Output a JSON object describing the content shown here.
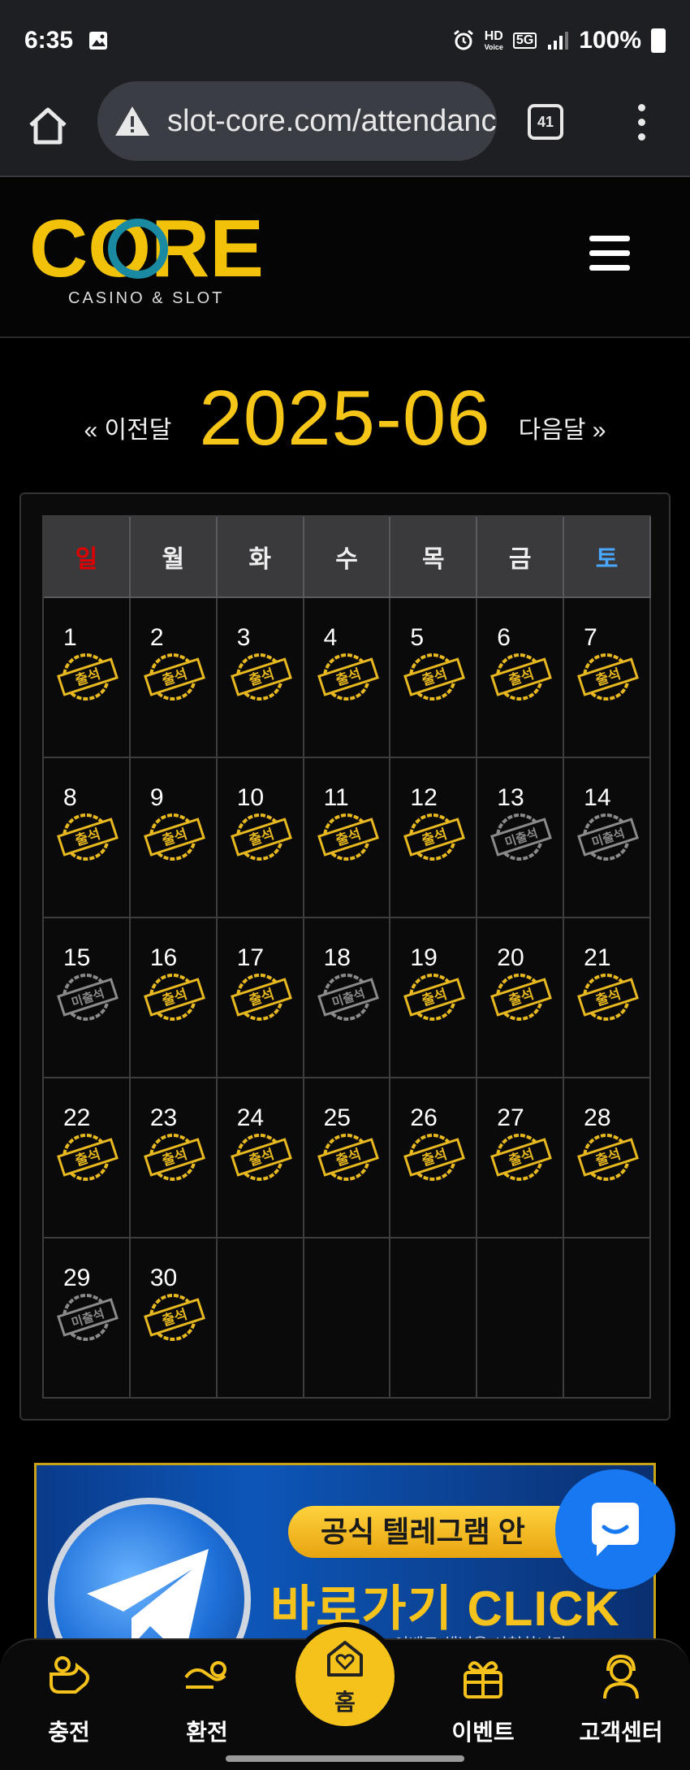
{
  "status_bar": {
    "time": "6:35",
    "hd_label": "HD",
    "voice_label": "Voice",
    "network": "5G",
    "battery": "100%"
  },
  "browser": {
    "url": "slot-core.com/attendance",
    "tab_count": "41"
  },
  "site": {
    "logo_text": "CORE",
    "logo_subtitle": "CASINO & SLOT"
  },
  "calendar": {
    "prev_label": "« 이전달",
    "next_label": "다음달 »",
    "month": "2025-06",
    "weekdays": [
      "일",
      "월",
      "화",
      "수",
      "목",
      "금",
      "토"
    ],
    "attended_label": "출석",
    "absent_label": "미출석",
    "days": [
      {
        "day": "1",
        "status": "attended"
      },
      {
        "day": "2",
        "status": "attended"
      },
      {
        "day": "3",
        "status": "attended"
      },
      {
        "day": "4",
        "status": "attended"
      },
      {
        "day": "5",
        "status": "attended"
      },
      {
        "day": "6",
        "status": "attended"
      },
      {
        "day": "7",
        "status": "attended"
      },
      {
        "day": "8",
        "status": "attended"
      },
      {
        "day": "9",
        "status": "attended"
      },
      {
        "day": "10",
        "status": "attended"
      },
      {
        "day": "11",
        "status": "attended"
      },
      {
        "day": "12",
        "status": "attended"
      },
      {
        "day": "13",
        "status": "absent"
      },
      {
        "day": "14",
        "status": "absent"
      },
      {
        "day": "15",
        "status": "absent"
      },
      {
        "day": "16",
        "status": "attended"
      },
      {
        "day": "17",
        "status": "attended"
      },
      {
        "day": "18",
        "status": "absent"
      },
      {
        "day": "19",
        "status": "attended"
      },
      {
        "day": "20",
        "status": "attended"
      },
      {
        "day": "21",
        "status": "attended"
      },
      {
        "day": "22",
        "status": "attended"
      },
      {
        "day": "23",
        "status": "attended"
      },
      {
        "day": "24",
        "status": "attended"
      },
      {
        "day": "25",
        "status": "attended"
      },
      {
        "day": "26",
        "status": "attended"
      },
      {
        "day": "27",
        "status": "attended"
      },
      {
        "day": "28",
        "status": "attended"
      },
      {
        "day": "29",
        "status": "absent"
      },
      {
        "day": "30",
        "status": "attended"
      },
      {
        "day": "",
        "status": "empty"
      },
      {
        "day": "",
        "status": "empty"
      },
      {
        "day": "",
        "status": "empty"
      },
      {
        "day": "",
        "status": "empty"
      },
      {
        "day": "",
        "status": "empty"
      }
    ]
  },
  "banner": {
    "pill_text": "공식 텔레그램 안",
    "cta_text": "바로가기 CLICK",
    "sub_text": "이벤트 채널을 시청하니다"
  },
  "bottom_nav": {
    "charge": "충전",
    "exchange": "환전",
    "home": "홈",
    "event": "이벤트",
    "support": "고객센터"
  },
  "colors": {
    "accent_gold": "#f5c518",
    "sunday_red": "#e00000",
    "saturday_blue": "#4aa8ff",
    "chat_blue": "#1778f2"
  }
}
